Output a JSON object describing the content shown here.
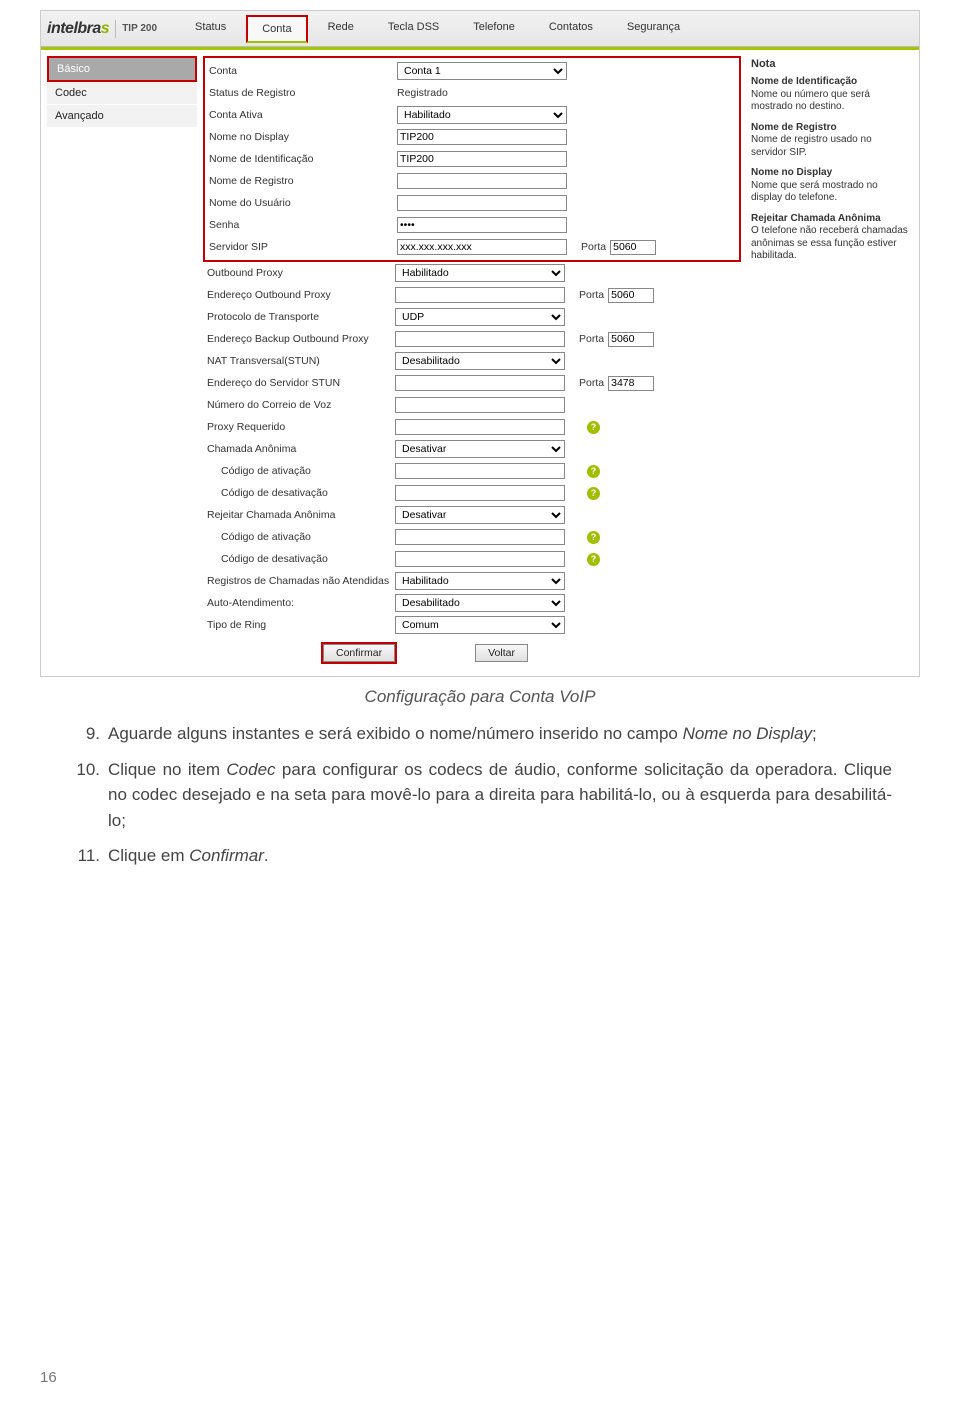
{
  "logo": {
    "text_main": "intelbra",
    "text_accent": "s",
    "model": "TIP 200"
  },
  "tabs": [
    "Status",
    "Conta",
    "Rede",
    "Tecla DSS",
    "Telefone",
    "Contatos",
    "Segurança"
  ],
  "tabs_active": 1,
  "sidebar": {
    "items": [
      "Básico",
      "Codec",
      "Avançado"
    ],
    "active": 0
  },
  "form": {
    "rows": [
      {
        "label": "Conta",
        "type": "select",
        "value": "Conta 1",
        "hl": true
      },
      {
        "label": "Status de Registro",
        "type": "text_static",
        "value": "Registrado",
        "hl": true
      },
      {
        "label": "Conta Ativa",
        "type": "select",
        "value": "Habilitado",
        "hl": true
      },
      {
        "label": "Nome no Display",
        "type": "input",
        "value": "TIP200",
        "hl": true
      },
      {
        "label": "Nome de Identificação",
        "type": "input",
        "value": "TIP200",
        "hl": true
      },
      {
        "label": "Nome de Registro",
        "type": "input",
        "value": "",
        "hl": true
      },
      {
        "label": "Nome do Usuário",
        "type": "input",
        "value": "",
        "hl": true
      },
      {
        "label": "Senha",
        "type": "password",
        "value": "••••",
        "hl": true
      },
      {
        "label": "Servidor SIP",
        "type": "input",
        "value": "xxx.xxx.xxx.xxx",
        "hl": true,
        "porta": "5060"
      },
      {
        "label": "Outbound Proxy",
        "type": "select",
        "value": "Habilitado"
      },
      {
        "label": "Endereço Outbound Proxy",
        "type": "input",
        "value": "",
        "porta": "5060"
      },
      {
        "label": "Protocolo de Transporte",
        "type": "select",
        "value": "UDP"
      },
      {
        "label": "Endereço Backup Outbound Proxy",
        "type": "input",
        "value": "",
        "porta": "5060"
      },
      {
        "label": "NAT Transversal(STUN)",
        "type": "select",
        "value": "Desabilitado"
      },
      {
        "label": "Endereço do Servidor STUN",
        "type": "input",
        "value": "",
        "porta": "3478"
      },
      {
        "label": "Número do Correio de Voz",
        "type": "input",
        "value": ""
      },
      {
        "label": "Proxy Requerido",
        "type": "input",
        "value": "",
        "help": true
      },
      {
        "label": "Chamada Anônima",
        "type": "select",
        "value": "Desativar"
      },
      {
        "label": "Código de ativação",
        "type": "input",
        "value": "",
        "help": true,
        "indent": true
      },
      {
        "label": "Código de desativação",
        "type": "input",
        "value": "",
        "help": true,
        "indent": true
      },
      {
        "label": "Rejeitar Chamada Anônima",
        "type": "select",
        "value": "Desativar"
      },
      {
        "label": "Código de ativação",
        "type": "input",
        "value": "",
        "help": true,
        "indent": true
      },
      {
        "label": "Código de desativação",
        "type": "input",
        "value": "",
        "help": true,
        "indent": true
      },
      {
        "label": "Registros de Chamadas não Atendidas",
        "type": "select",
        "value": "Habilitado"
      },
      {
        "label": "Auto-Atendimento:",
        "type": "select",
        "value": "Desabilitado"
      },
      {
        "label": "Tipo de Ring",
        "type": "select",
        "value": "Comum"
      }
    ],
    "buttons": {
      "confirm": "Confirmar",
      "back": "Voltar"
    },
    "porta_label": "Porta"
  },
  "notes": {
    "title": "Nota",
    "items": [
      {
        "t": "Nome de Identificação",
        "d": "Nome ou número que será mostrado no destino."
      },
      {
        "t": "Nome de Registro",
        "d": "Nome de registro usado no servidor SIP."
      },
      {
        "t": "Nome no Display",
        "d": "Nome que será mostrado no display do telefone."
      },
      {
        "t": "Rejeitar Chamada Anônima",
        "d": "O telefone não receberá chamadas anônimas se essa função estiver habilitada."
      }
    ]
  },
  "caption": "Configuração para Conta VoIP",
  "instructions": [
    {
      "n": "9.",
      "t": "Aguarde alguns instantes e será exibido o nome/número inserido no campo <em>Nome no Display</em>;"
    },
    {
      "n": "10.",
      "t": "Clique no item <em>Codec</em> para configurar os codecs de áudio, conforme solicitação da operadora. Clique no codec desejado e na seta para movê-lo para a direita para habilitá-lo, ou à esquerda para desabilitá-lo;"
    },
    {
      "n": "11.",
      "t": "Clique em <em>Confirmar</em>."
    }
  ],
  "page_number": "16"
}
